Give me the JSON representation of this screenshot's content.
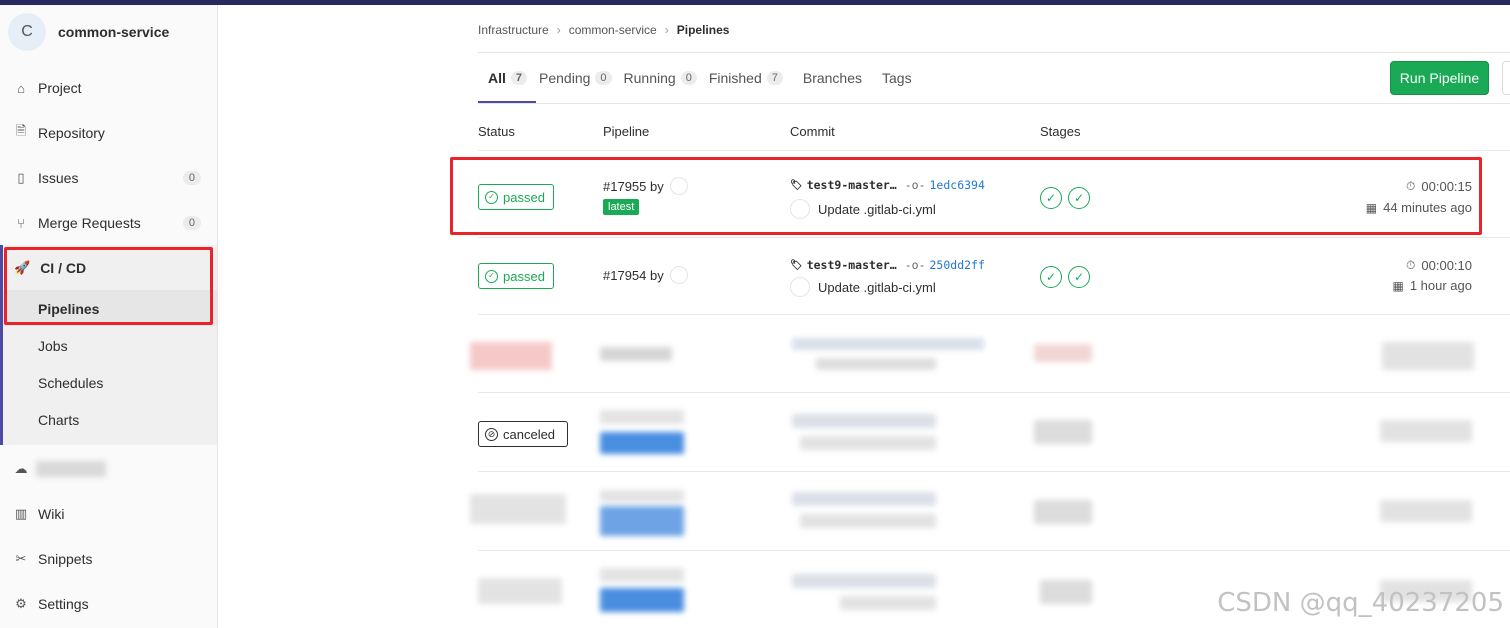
{
  "sidebar": {
    "project_initial": "C",
    "project_name": "common-service",
    "items": [
      {
        "label": "Project",
        "icon": "home-icon"
      },
      {
        "label": "Repository",
        "icon": "file-icon"
      },
      {
        "label": "Issues",
        "icon": "issues-icon",
        "count": "0"
      },
      {
        "label": "Merge Requests",
        "icon": "merge-icon",
        "count": "0"
      },
      {
        "label": "CI / CD",
        "icon": "rocket-icon"
      },
      {
        "label": "Wiki",
        "icon": "book-icon"
      },
      {
        "label": "Snippets",
        "icon": "scissors-icon"
      },
      {
        "label": "Settings",
        "icon": "gear-icon"
      }
    ],
    "ci_sub": [
      "Pipelines",
      "Jobs",
      "Schedules",
      "Charts"
    ]
  },
  "breadcrumb": [
    "Infrastructure",
    "common-service",
    "Pipelines"
  ],
  "tabs": [
    {
      "label": "All",
      "count": "7"
    },
    {
      "label": "Pending",
      "count": "0"
    },
    {
      "label": "Running",
      "count": "0"
    },
    {
      "label": "Finished",
      "count": "7"
    },
    {
      "label": "Branches"
    },
    {
      "label": "Tags"
    }
  ],
  "run_pipeline_label": "Run Pipeline",
  "columns": [
    "Status",
    "Pipeline",
    "Commit",
    "Stages"
  ],
  "rows": [
    {
      "status": "passed",
      "pipeline": "#17955 by",
      "badge": "latest",
      "ref": "test9-master…",
      "sha": "1edc6394",
      "title": "Update .gitlab-ci.yml",
      "duration": "00:00:15",
      "finished": "44 minutes ago"
    },
    {
      "status": "passed",
      "pipeline": "#17954 by",
      "ref": "test9-master…",
      "sha": "250dd2ff",
      "title": "Update .gitlab-ci.yml",
      "duration": "00:00:10",
      "finished": "1 hour ago"
    }
  ],
  "canceled_label": "canceled",
  "watermark": "CSDN @qq_40237205",
  "colors": {
    "accent": "#4b4ba3",
    "success": "#1aaa55",
    "highlight": "#e8242a"
  }
}
